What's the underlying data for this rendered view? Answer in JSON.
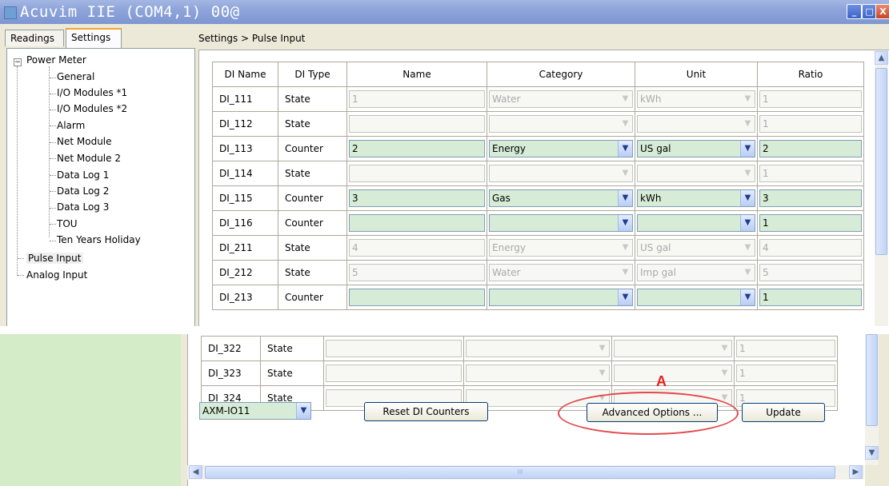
{
  "window": {
    "title": "Acuvim IIE (COM4,1) 00@",
    "minimize_glyph": "_",
    "maximize_glyph": "□",
    "close_glyph": "X"
  },
  "tabs": [
    {
      "label": "Readings",
      "active": false
    },
    {
      "label": "Settings",
      "active": true
    }
  ],
  "breadcrumb": "Settings > Pulse Input",
  "tree": {
    "root_toggle": "−",
    "root": "Power Meter",
    "children": [
      "General",
      "I/O Modules *1",
      "I/O Modules *2",
      "Alarm",
      "Net Module",
      "Net Module 2",
      "Data Log 1",
      "Data Log 2",
      "Data Log 3",
      "TOU",
      "Ten Years Holiday"
    ],
    "siblings": [
      "Pulse Input",
      "Analog Input"
    ],
    "selected": "Pulse Input"
  },
  "grid": {
    "columns": [
      "DI Name",
      "DI Type",
      "Name",
      "Category",
      "Unit",
      "Ratio"
    ],
    "dropdown_glyph": "▼",
    "rows": [
      {
        "di": "DI_111",
        "type": "State",
        "name": "1",
        "category": "Water",
        "unit": "kWh",
        "ratio": "1",
        "enabled": false
      },
      {
        "di": "DI_112",
        "type": "State",
        "name": "",
        "category": "",
        "unit": "",
        "ratio": "1",
        "enabled": false
      },
      {
        "di": "DI_113",
        "type": "Counter",
        "name": "2",
        "category": "Energy",
        "unit": "US gal",
        "ratio": "2",
        "enabled": true
      },
      {
        "di": "DI_114",
        "type": "State",
        "name": "",
        "category": "",
        "unit": "",
        "ratio": "1",
        "enabled": false
      },
      {
        "di": "DI_115",
        "type": "Counter",
        "name": "3",
        "category": "Gas",
        "unit": "kWh",
        "ratio": "3",
        "enabled": true
      },
      {
        "di": "DI_116",
        "type": "Counter",
        "name": "",
        "category": "",
        "unit": "",
        "ratio": "1",
        "enabled": true
      },
      {
        "di": "DI_211",
        "type": "State",
        "name": "4",
        "category": "Energy",
        "unit": "US gal",
        "ratio": "4",
        "enabled": false
      },
      {
        "di": "DI_212",
        "type": "State",
        "name": "5",
        "category": "Water",
        "unit": "Imp gal",
        "ratio": "5",
        "enabled": false
      },
      {
        "di": "DI_213",
        "type": "Counter",
        "name": "",
        "category": "",
        "unit": "",
        "ratio": "1",
        "enabled": true
      }
    ]
  },
  "bottom_grid": {
    "rows": [
      {
        "di": "DI_322",
        "type": "State",
        "ratio": "1"
      },
      {
        "di": "DI_323",
        "type": "State",
        "ratio": "1"
      },
      {
        "di": "DI_324",
        "type": "State",
        "ratio": "1"
      }
    ]
  },
  "controls": {
    "module_select": "AXM-IO11",
    "reset_button": "Reset DI Counters",
    "advanced_button": "Advanced Options ...",
    "update_button": "Update",
    "annotation_marker": "A"
  },
  "scroll": {
    "up_glyph": "▲",
    "down_glyph": "▼",
    "left_glyph": "◀",
    "right_glyph": "▶",
    "grip_glyph": "III"
  },
  "colors": {
    "enabled_field": "#d6ecd6",
    "annotation": "#e52222",
    "title_bar": "#8ea4da"
  }
}
